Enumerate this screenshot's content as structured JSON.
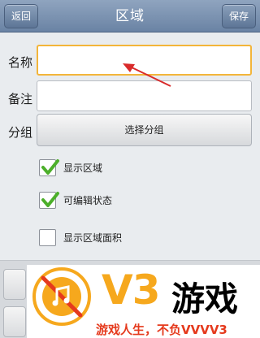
{
  "navbar": {
    "title": "区域",
    "back_label": "返回",
    "save_label": "保存"
  },
  "form": {
    "name_label": "名称",
    "name_value": "",
    "note_label": "备注",
    "note_value": "",
    "group_label": "分组",
    "group_button_label": "选择分组"
  },
  "options": [
    {
      "label": "显示区域",
      "checked": true
    },
    {
      "label": "可编辑状态",
      "checked": true
    },
    {
      "label": "显示区域面积",
      "checked": false
    }
  ],
  "watermark": {
    "logo_text": "V3",
    "brand": "游戏",
    "slogan": "游戏人生，不负VVVV3"
  },
  "colors": {
    "navbar": "#7a91b0",
    "focus_border": "#f3b53a",
    "check_green": "#4caf2a",
    "annotation_arrow": "#d92b2b",
    "watermark_orange": "#f6a81d",
    "watermark_red": "#e53a1d"
  }
}
